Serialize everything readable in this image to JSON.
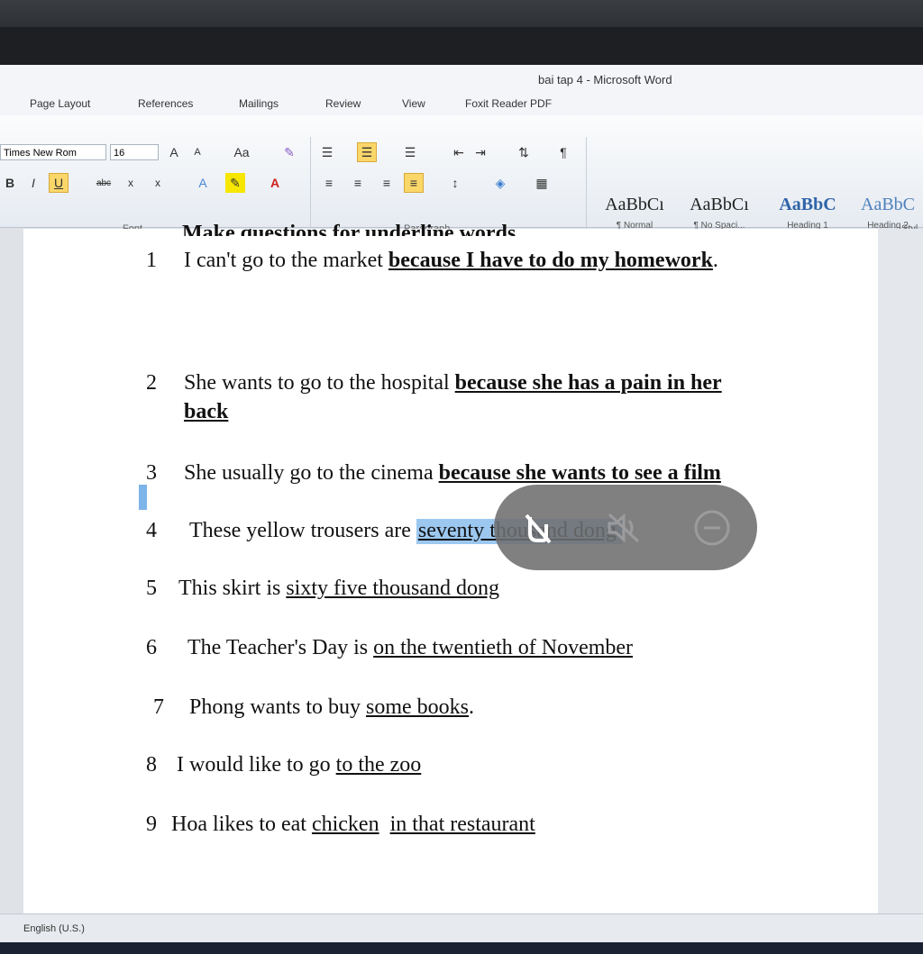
{
  "window": {
    "title": "bai tap 4 - Microsoft Word"
  },
  "tabs": [
    "Page Layout",
    "References",
    "Mailings",
    "Review",
    "View",
    "Foxit Reader PDF"
  ],
  "ribbon": {
    "font_name": "Times New Rom",
    "font_size": "16",
    "grow_font": "A",
    "shrink_font": "A",
    "change_case": "Aa",
    "bold": "B",
    "italic": "I",
    "underline": "U",
    "strike": "abc",
    "subscript": "x",
    "superscript": "x",
    "font_group": "Font",
    "paragraph_group": "Paragraph",
    "styles_group": "Styl",
    "styles": [
      {
        "preview": "AaBbCı",
        "name": "¶ Normal"
      },
      {
        "preview": "AaBbCı",
        "name": "¶ No Spaci..."
      },
      {
        "preview": "AaBbC",
        "name": "Heading 1"
      },
      {
        "preview": "AaBbC",
        "name": "Heading 2"
      }
    ],
    "heading_color": "#2f63a8"
  },
  "document": {
    "heading_partial": "Make questions for underline words",
    "items": [
      {
        "num": "1",
        "text": "I can't go to the market ",
        "under": "because I have to do my homework",
        "after": "."
      },
      {
        "num": "2",
        "text": "She wants to go to the hospital ",
        "under": "because she has a pain in her",
        "under2": "back"
      },
      {
        "num": "3",
        "text": "She usually go to the cinema ",
        "under": "because she wants to see a film"
      },
      {
        "num": "4",
        "text": "These yellow trousers are ",
        "highlight": "seventy thousand dong"
      },
      {
        "num": "5",
        "text": "This skirt is ",
        "under": "sixty five thousand dong"
      },
      {
        "num": "6",
        "text": "The Teacher's Day is ",
        "under": "on the twentieth of November"
      },
      {
        "num": "7",
        "text": "Phong wants to buy ",
        "under": "some books",
        "after": "."
      },
      {
        "num": "8",
        "text": "I would like to go ",
        "under": "to the zoo"
      },
      {
        "num": "9",
        "text": "Hoa likes to eat ",
        "under": "chicken",
        "under_b": "in that restaurant"
      }
    ]
  },
  "overlay": {
    "icons": [
      "no-hand-icon",
      "mute-icon",
      "minus-circle-icon"
    ],
    "color": "#6e6e70"
  },
  "statusbar": {
    "language": "English (U.S.)"
  }
}
